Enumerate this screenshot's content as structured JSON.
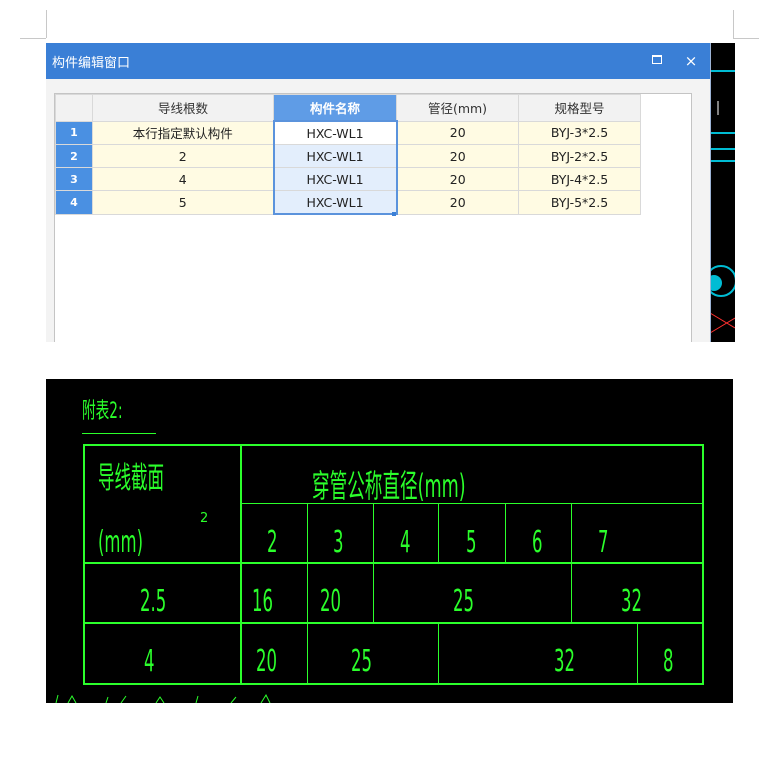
{
  "window": {
    "title": "构件编辑窗口",
    "maximize_glyph": "□",
    "close_glyph": "×"
  },
  "grid": {
    "headers": [
      "导线根数",
      "构件名称",
      "管径(mm)",
      "规格型号"
    ],
    "rows": [
      {
        "num": "1",
        "wires": "本行指定默认构件",
        "name": "HXC-WL1",
        "diameter": "20",
        "spec": "BYJ-3*2.5"
      },
      {
        "num": "2",
        "wires": "2",
        "name": "HXC-WL1",
        "diameter": "20",
        "spec": "BYJ-2*2.5"
      },
      {
        "num": "3",
        "wires": "4",
        "name": "HXC-WL1",
        "diameter": "20",
        "spec": "BYJ-4*2.5"
      },
      {
        "num": "4",
        "wires": "5",
        "name": "HXC-WL1",
        "diameter": "20",
        "spec": "BYJ-5*2.5"
      }
    ]
  },
  "cad_table": {
    "title": "附表2:",
    "header_left": "导线截面",
    "header_left_unit": "(mm)",
    "superscript": "2",
    "header_right": "穿管公称直径(mm)",
    "counts": [
      "2",
      "3",
      "4",
      "5",
      "6",
      "7"
    ],
    "row1": {
      "section": "2.5",
      "values": [
        "16",
        "20",
        "25",
        "32"
      ]
    },
    "row2": {
      "section": "4",
      "values": [
        "20",
        "25",
        "32",
        "8"
      ]
    }
  },
  "colors": {
    "titlebar": "#3a7fd6",
    "selected_header": "#5f9ce6",
    "row_number": "#4a90e2",
    "cad_line": "#2bff2b",
    "cad_background": "#000000"
  }
}
